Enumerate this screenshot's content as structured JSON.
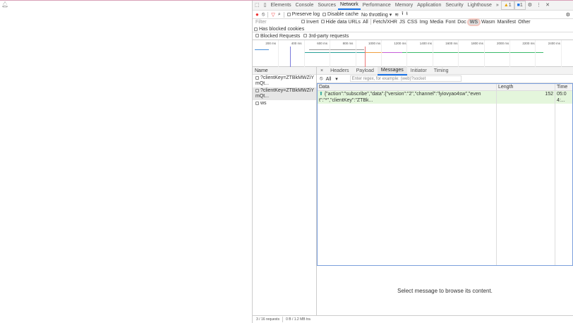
{
  "tabs": [
    "Elements",
    "Console",
    "Sources",
    "Network",
    "Performance",
    "Memory",
    "Application",
    "Security",
    "Lighthouse"
  ],
  "active_tab": "Network",
  "more": "»",
  "warn_count": "1",
  "msg_count": "1",
  "toolbar": {
    "preserve_log": "Preserve log",
    "disable_cache": "Disable cache",
    "throttling": "No throttling"
  },
  "filter": {
    "placeholder": "Filter",
    "invert": "Invert",
    "hide_data_urls": "Hide data URLs",
    "types": [
      "All",
      "Fetch/XHR",
      "JS",
      "CSS",
      "Img",
      "Media",
      "Font",
      "Doc",
      "WS",
      "Wasm",
      "Manifest",
      "Other"
    ],
    "active_type": "WS",
    "has_blocked_cookies": "Has blocked cookies",
    "blocked_requests": "Blocked Requests",
    "third_party": "3rd-party requests"
  },
  "timeline_ticks": [
    "200 ms",
    "400 ms",
    "600 ms",
    "800 ms",
    "1000 ms",
    "1200 ms",
    "1400 ms",
    "1600 ms",
    "1800 ms",
    "2000 ms",
    "2200 ms",
    "2400 ms"
  ],
  "requests": {
    "header": "Name",
    "items": [
      "?clientKey=ZTBkMWZiYmQt...",
      "?clientKey=ZTBkMWZiYmQt...",
      "ws"
    ]
  },
  "detail": {
    "close": "×",
    "tabs": [
      "Headers",
      "Payload",
      "Messages",
      "Initiator",
      "Timing"
    ],
    "active": "Messages",
    "filter_value": "All",
    "regex_placeholder": "Enter regex, for example: (web)?socket",
    "columns": [
      "Data",
      "Length",
      "Time"
    ],
    "messages": [
      {
        "data": "{\"action\":\"subscribe\",\"data\":{\"version\":\"2\",\"channel\":\"lyiovyao4sw\",\"event\":\"*\",\"clientKey\":\"ZTBk...",
        "length": "152",
        "time": "05:04:..."
      }
    ],
    "empty": "Select message to browse its content."
  },
  "status": {
    "requests": "3 / 16 requests",
    "transferred": "0 B / 1.2 MB tra"
  }
}
